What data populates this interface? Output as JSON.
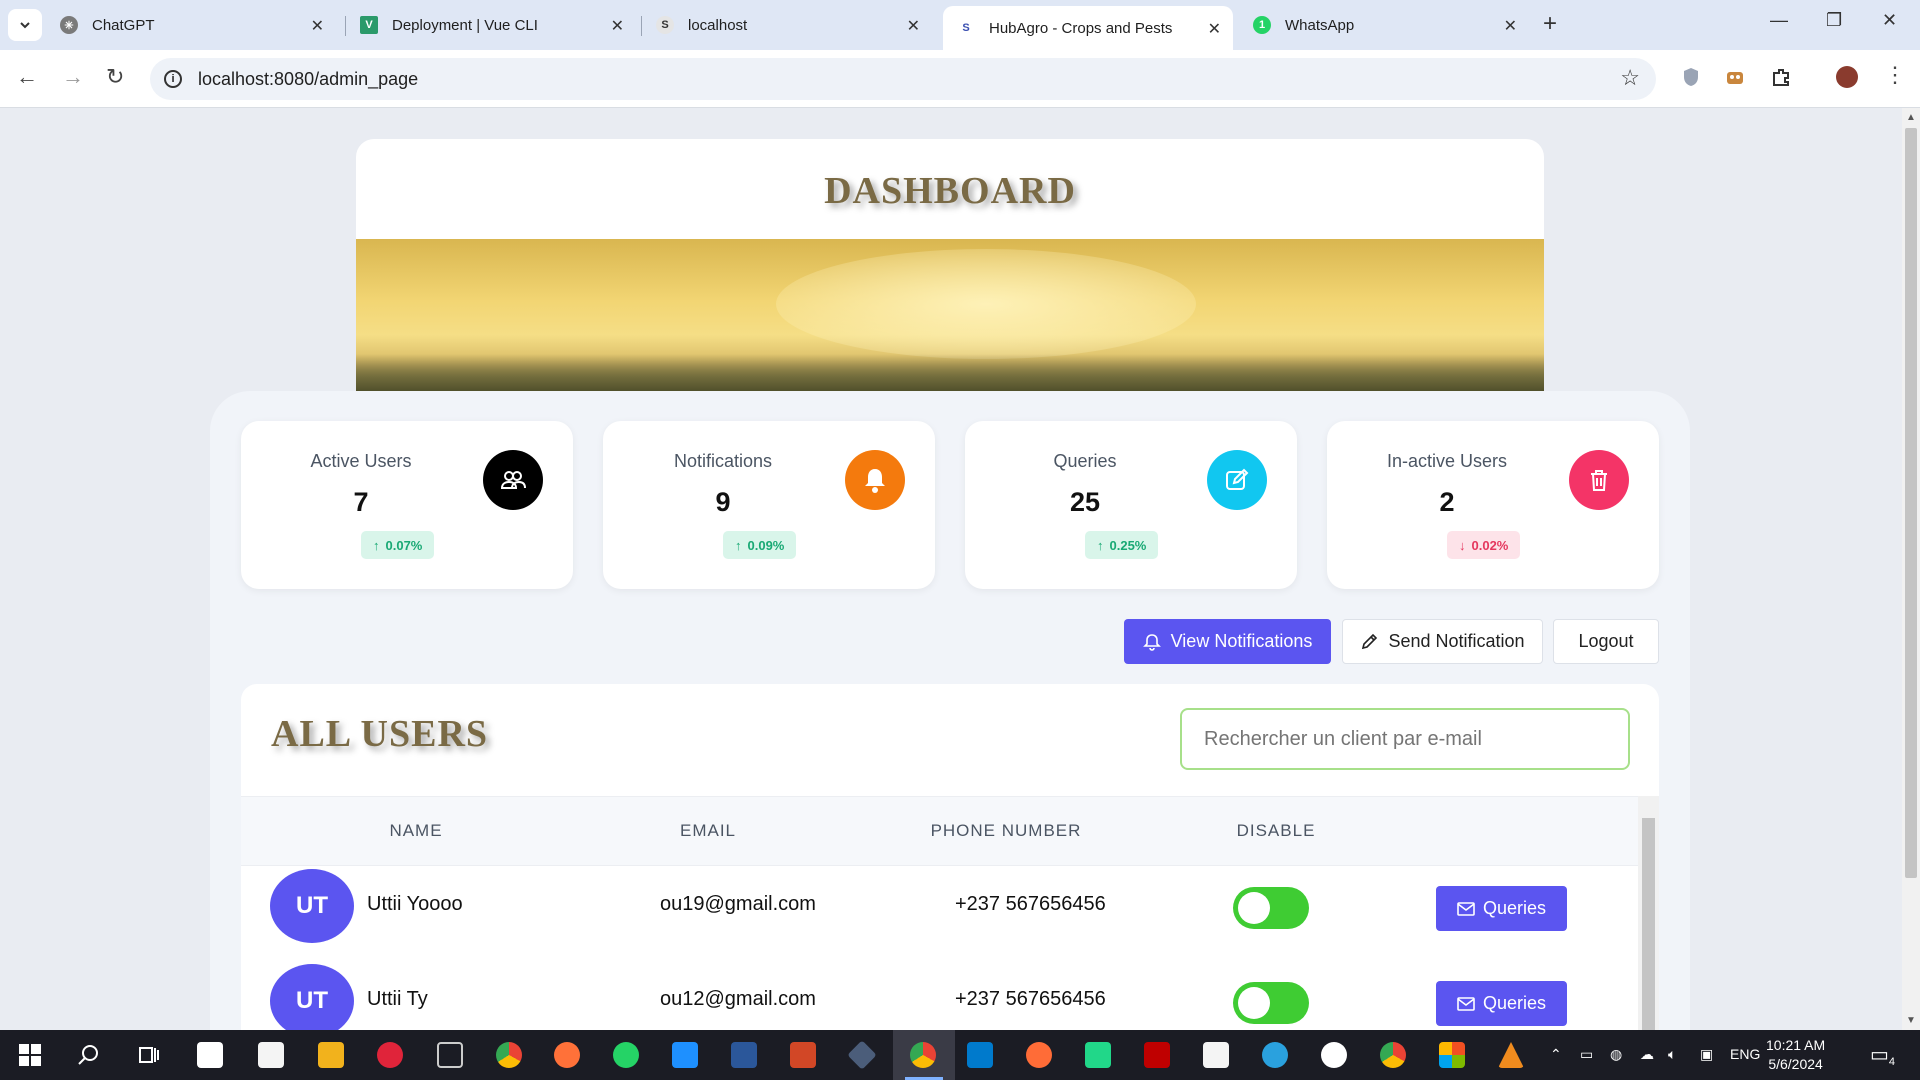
{
  "browser": {
    "tabs": [
      {
        "title": "ChatGPT",
        "favicon": "chatgpt-icon",
        "color": "#7a7a7a"
      },
      {
        "title": "Deployment | Vue CLI",
        "favicon": "vue-icon",
        "color": "#2b9a6a"
      },
      {
        "title": "localhost",
        "favicon": "s-icon",
        "color": "#888"
      },
      {
        "title": "HubAgro - Crops and Pests",
        "favicon": "s-icon",
        "color": "#3a4fb0"
      },
      {
        "title": "WhatsApp",
        "favicon": "whatsapp-icon",
        "color": "#25d366"
      }
    ],
    "url": "localhost:8080/admin_page"
  },
  "dashboard": {
    "title": "DASHBOARD",
    "stats": [
      {
        "label": "Active Users",
        "value": "7",
        "trend": "0.07%",
        "direction": "up",
        "icon": "users-icon",
        "icon_color": "#000000"
      },
      {
        "label": "Notifications",
        "value": "9",
        "trend": "0.09%",
        "direction": "up",
        "icon": "bell-icon",
        "icon_color": "#f47a0d"
      },
      {
        "label": "Queries",
        "value": "25",
        "trend": "0.25%",
        "direction": "up",
        "icon": "edit-icon",
        "icon_color": "#11c7f0"
      },
      {
        "label": "In-active Users",
        "value": "2",
        "trend": "0.02%",
        "direction": "down",
        "icon": "trash-icon",
        "icon_color": "#f43467"
      }
    ],
    "actions": {
      "view_notifications": "View Notifications",
      "send_notification": "Send Notification",
      "logout": "Logout"
    }
  },
  "users": {
    "title": "ALL USERS",
    "search_placeholder": "Rechercher un client par e-mail",
    "columns": [
      "NAME",
      "EMAIL",
      "PHONE NUMBER",
      "DISABLE"
    ],
    "rows": [
      {
        "initials": "UT",
        "name": "Uttii Yoooo",
        "email": "ou19@gmail.com",
        "phone": "+237 567656456",
        "enabled": true,
        "action": "Queries"
      },
      {
        "initials": "UT",
        "name": "Uttii Ty",
        "email": "ou12@gmail.com",
        "phone": "+237 567656456",
        "enabled": true,
        "action": "Queries"
      }
    ]
  },
  "taskbar": {
    "language": "ENG",
    "time": "10:21 AM",
    "date": "5/6/2024",
    "notification_count": "4"
  }
}
